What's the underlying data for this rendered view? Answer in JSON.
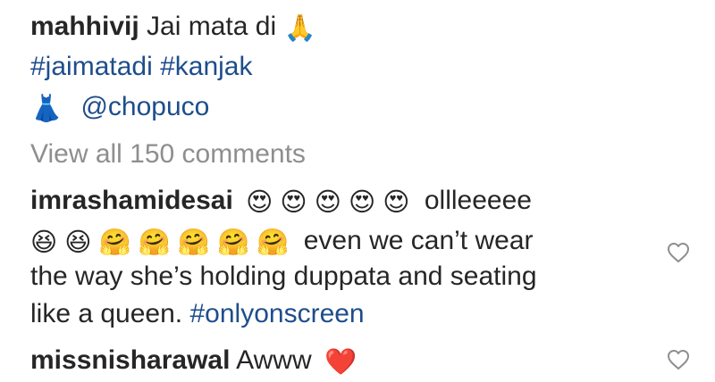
{
  "caption": {
    "username": "mahhivij",
    "text": "Jai mata di",
    "text_emoji": "🙏",
    "hashtags": "#jaimatadi #kanjak",
    "credit_emoji": "👗",
    "credit_mention": "@chopuco"
  },
  "view_all_comments": "View all 150 comments",
  "comments": [
    {
      "username": "imrashamidesai",
      "line1_emojis": "😍 😍 😍 😍 😍",
      "line1_text": "ollleeeee",
      "line2_emojis": "😆 😆 🤗 🤗 🤗 🤗 🤗",
      "line2_text": "even we can’t wear",
      "line3_text": "the way she’s holding duppata and seating",
      "line4_text": "like a queen.",
      "line4_hashtag": "#onlyonscreen",
      "like_icon": "heart-outline-icon"
    },
    {
      "username": "missnisharawal",
      "text": "Awww",
      "emoji": "❤️",
      "like_icon": "heart-outline-icon"
    }
  ],
  "colors": {
    "text": "#262626",
    "hashtag": "#1e4d8c",
    "muted": "#8e8e8e",
    "icon": "#8e8e8e"
  }
}
